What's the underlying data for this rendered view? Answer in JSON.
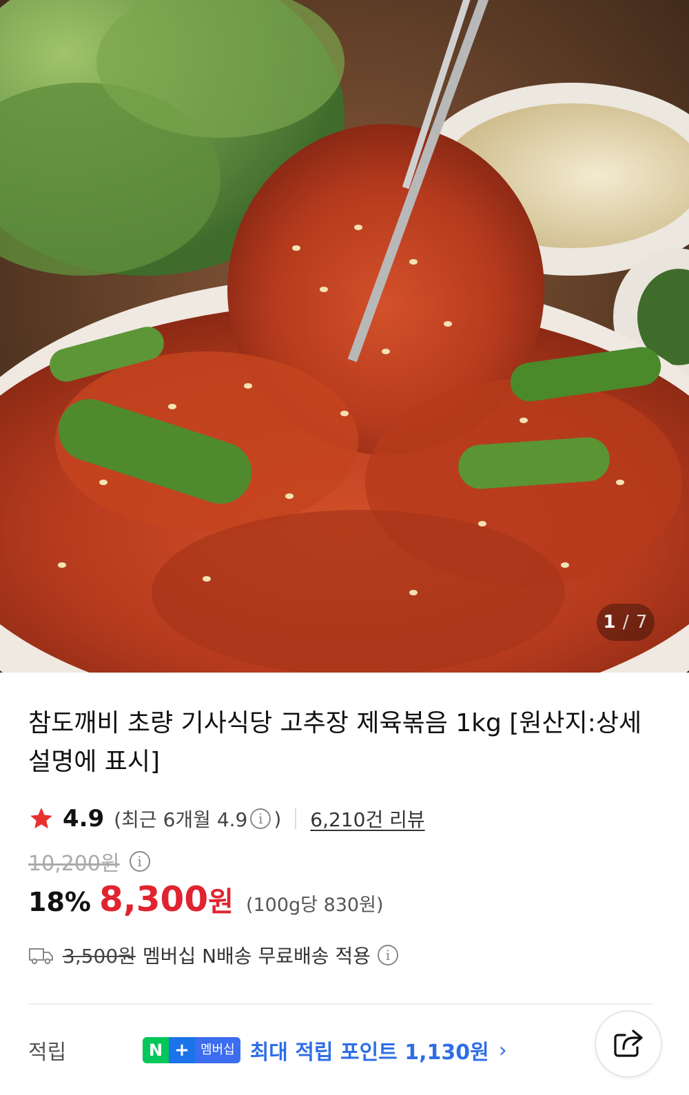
{
  "gallery": {
    "current": "1",
    "separator": "/",
    "total": "7",
    "image_desc_icon": "food-photo"
  },
  "product": {
    "title": "참도깨비 초량 기사식당 고추장 제육볶음 1kg [원산지:상세설명에 표시]"
  },
  "rating": {
    "score": "4.9",
    "recent_label": "(최근 6개월 4.9",
    "recent_close": ")",
    "review_count": "6,210건 리뷰",
    "star_color": "#e8312f"
  },
  "price": {
    "original": "10,200원",
    "discount": "18%",
    "amount": "8,300",
    "unit": "원",
    "unit_price": "(100g당 830원)",
    "accent_color": "#e0242f"
  },
  "shipping": {
    "fee": "3,500원",
    "text": "멤버십 N배송 무료배송 적용"
  },
  "points": {
    "label": "적립",
    "badge_n": "N",
    "badge_plus": "+",
    "badge_label": "멤버십",
    "text": "최대 적립 포인트 1,130원",
    "chevron": "›",
    "accent_color": "#2f6ee6"
  },
  "share": {
    "icon": "share-icon"
  }
}
